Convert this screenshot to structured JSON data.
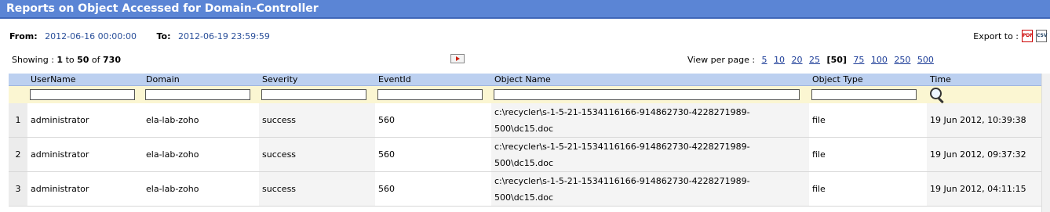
{
  "header": {
    "title": "Reports on Object Accessed for Domain-Controller"
  },
  "range": {
    "from_label": "From:",
    "from_value": "2012-06-16 00:00:00",
    "to_label": "To:",
    "to_value": "2012-06-19 23:59:59"
  },
  "export": {
    "label": "Export to :",
    "pdf_icon": "PDF",
    "csv_icon": "CSV"
  },
  "paging": {
    "showing_label": "Showing :",
    "start": "1",
    "to_word": "to",
    "end": "50",
    "of_word": "of",
    "total": "730",
    "per_page_label": "View per page :",
    "per_page_options_before": [
      "5",
      "10",
      "20",
      "25"
    ],
    "current": "[50]",
    "per_page_options_after": [
      "75",
      "100",
      "250",
      "500"
    ]
  },
  "table": {
    "columns": [
      "UserName",
      "Domain",
      "Severity",
      "EventId",
      "Object Name",
      "Object Type",
      "Time"
    ],
    "rows": [
      {
        "num": "1",
        "user": "administrator",
        "domain": "ela-lab-zoho",
        "severity": "success",
        "event_id": "560",
        "object_line1": "c:\\recycler\\s-1-5-21-1534116166-914862730-4228271989-",
        "object_line2": "500\\dc15.doc",
        "object_type": "file",
        "time": "19 Jun 2012, 10:39:38"
      },
      {
        "num": "2",
        "user": "administrator",
        "domain": "ela-lab-zoho",
        "severity": "success",
        "event_id": "560",
        "object_line1": "c:\\recycler\\s-1-5-21-1534116166-914862730-4228271989-",
        "object_line2": "500\\dc15.doc",
        "object_type": "file",
        "time": "19 Jun 2012, 09:37:32"
      },
      {
        "num": "3",
        "user": "administrator",
        "domain": "ela-lab-zoho",
        "severity": "success",
        "event_id": "560",
        "object_line1": "c:\\recycler\\s-1-5-21-1534116166-914862730-4228271989-",
        "object_line2": "500\\dc15.doc",
        "object_type": "file",
        "time": "19 Jun 2012, 04:11:15"
      }
    ]
  },
  "colors": {
    "title_bar": "#5b85d5",
    "header_row": "#bcd0f0",
    "filter_row": "#fbf6d2",
    "link": "#1f3f99"
  }
}
